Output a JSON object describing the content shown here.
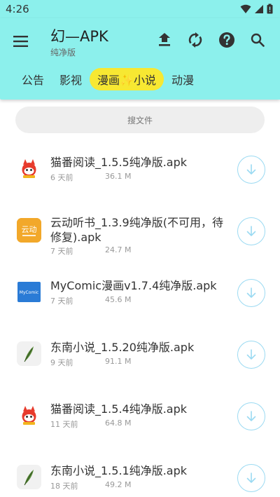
{
  "status": {
    "time": "4:26"
  },
  "header": {
    "title": "幻—APK",
    "subtitle": "纯净版"
  },
  "tabs": [
    {
      "label": "公告",
      "active": false
    },
    {
      "label": "影视",
      "active": false
    },
    {
      "label": "漫画✨小说",
      "active": true
    },
    {
      "label": "动漫",
      "active": false
    }
  ],
  "search": {
    "label": "搜文件"
  },
  "files": [
    {
      "name": "猫番阅读_1.5.5纯净版.apk",
      "age": "6 天前",
      "size": "36.1 M",
      "icon": "cat-reader-icon"
    },
    {
      "name": "云动听书_1.3.9纯净版(不可用，待修复).apk",
      "age": "7 天前",
      "size": "24.7 M",
      "icon": "yundong-icon"
    },
    {
      "name": "MyComic漫画v1.7.4纯净版.apk",
      "age": "7 天前",
      "size": "45.6 M",
      "icon": "mycomic-icon"
    },
    {
      "name": "东南小说_1.5.20纯净版.apk",
      "age": "9 天前",
      "size": "91.1 M",
      "icon": "feather-icon"
    },
    {
      "name": "猫番阅读_1.5.4纯净版.apk",
      "age": "11 天前",
      "size": "64.8 M",
      "icon": "cat-reader-icon"
    },
    {
      "name": "东南小说_1.5.1纯净版.apk",
      "age": "18 天前",
      "size": "49.2 M",
      "icon": "feather-icon"
    }
  ],
  "icon_labels": {
    "yundong": "云动",
    "mycomic": "MyComic"
  },
  "colors": {
    "bar": "#8cf0ec",
    "active_tab": "#f7e832",
    "download_ring": "#9bdaf2"
  }
}
